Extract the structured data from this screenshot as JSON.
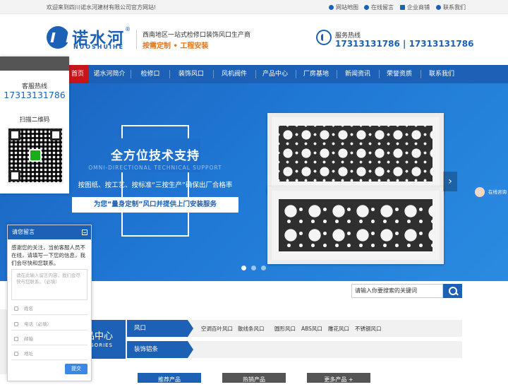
{
  "topbar": {
    "welcome": "欢迎来到四川诺水河建材有限公司官方网站!",
    "links": [
      {
        "label": "网站地图",
        "icon": "location-icon"
      },
      {
        "label": "在线留言",
        "icon": "pin-icon"
      },
      {
        "label": "企业商铺",
        "icon": "shop-icon"
      },
      {
        "label": "联系我们",
        "icon": "phone-icon"
      }
    ]
  },
  "header": {
    "logo_cn": "诺水河",
    "logo_en": "NUOSHUIHE",
    "logo_reg": "®",
    "slogan_line1": "西南地区一站式检修口装饰风口生产商",
    "slogan_line2": "按需定制 • 工程安装",
    "hotline_label": "服务热线",
    "hotline_number": "17313131786 | 17313131786"
  },
  "nav": {
    "items": [
      "首页",
      "诺水河简介",
      "检修口",
      "装饰风口",
      "风机阀件",
      "产品中心",
      "厂房基地",
      "新闻资讯",
      "荣誉资质",
      "联系我们"
    ],
    "active_index": 0
  },
  "banner": {
    "title": "全方位技术支持",
    "subtitle": "OMNI-DIRECTIONAL TECHNICAL SUPPORT",
    "line": "按图纸、按工艺、按标准“三按生产”确保出厂合格率",
    "box": "为您“量身定制”风口并提供上门安装服务",
    "next_arrow": "›",
    "slides": 3,
    "active_slide": 0
  },
  "side_panel": {
    "hotline_label": "客服热线",
    "hotline_number": "17313131786",
    "qr_label": "扫描二维码"
  },
  "online_tag": "在线咨询",
  "search": {
    "placeholder": "请输入你要搜索的关键词"
  },
  "category": {
    "title": "品中心",
    "subtitle": "SORIES",
    "rows": [
      {
        "tab": "风口",
        "items": [
          "空调百叶风口",
          "散线条风口",
          "圆形风口",
          "ABS风口",
          "雕花风口",
          "不锈钢风口"
        ]
      },
      {
        "tab": "装饰铝条",
        "items": []
      }
    ]
  },
  "bottom_tabs": [
    "推荐产品",
    "热销产品",
    "更多产品 +"
  ],
  "message": {
    "title": "请您留言",
    "intro": "感谢您的关注，当前客服人员不在线，请填写一下您的信息，我们会尽快和您联系。",
    "textarea_placeholder": "请在此输入留言内容，我们会尽快与您联系。（必填）",
    "fields": [
      "姓名",
      "电话（必填）",
      "邮箱",
      "地址"
    ],
    "submit": "提交"
  },
  "colors": {
    "primary": "#1c61b5",
    "active": "#c8151d",
    "accent": "#e5761a"
  }
}
